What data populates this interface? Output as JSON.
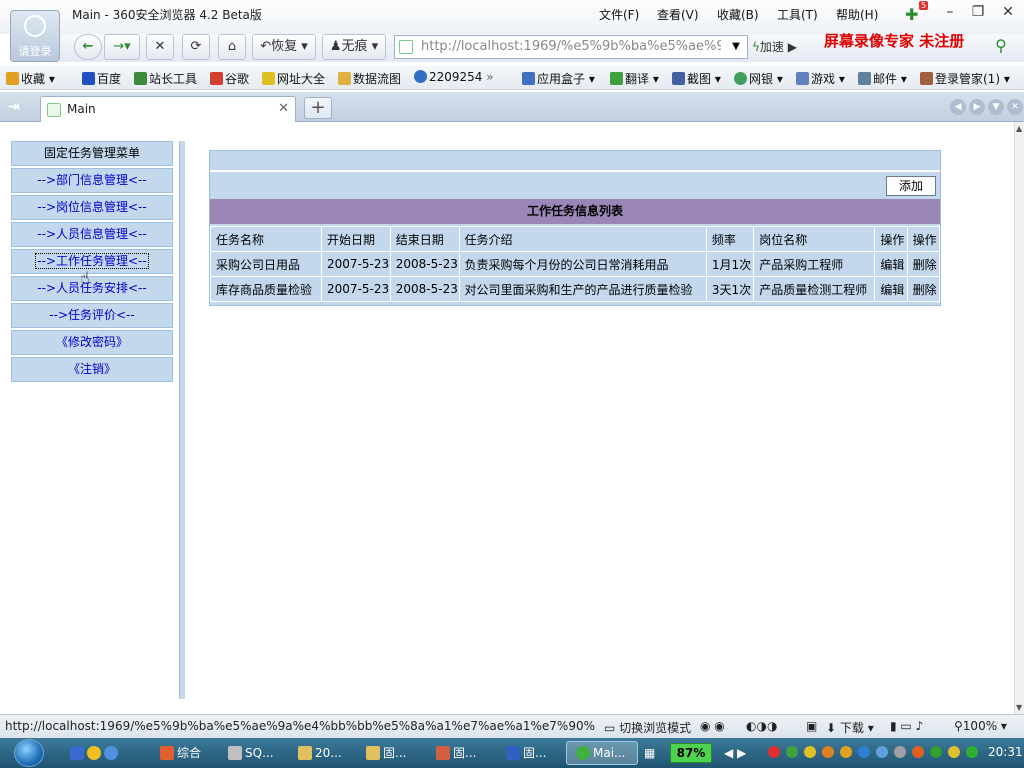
{
  "browser": {
    "window_title": "Main - 360安全浏览器 4.2 Beta版",
    "login_label": "请登录",
    "menu": [
      "文件(F)",
      "查看(V)",
      "收藏(B)",
      "工具(T)",
      "帮助(H)"
    ],
    "notify_count": "5",
    "toolbar": {
      "restore_label": "恢复",
      "notrace_label": "无痕",
      "accelerate_label": "加速"
    },
    "address_url": "http://localhost:1969/%e5%9b%ba%e5%ae%9",
    "watermark": "屏幕录像专家  未注册"
  },
  "bookmarks": [
    {
      "label": "收藏",
      "color": "#e0a020"
    },
    {
      "label": "百度",
      "color": "#2050c0"
    },
    {
      "label": "站长工具",
      "color": "#3a8a3a"
    },
    {
      "label": "谷歌",
      "color": "#d04030"
    },
    {
      "label": "网址大全",
      "color": "#e0c020"
    },
    {
      "label": "数据流图",
      "color": "#e0b040"
    },
    {
      "label": "2209254",
      "color": "#3070c0"
    },
    {
      "label": "应用盒子",
      "color": "#4070c0"
    },
    {
      "label": "翻译",
      "color": "#40a040"
    },
    {
      "label": "截图",
      "color": "#4060a0"
    },
    {
      "label": "网银",
      "color": "#40a060"
    },
    {
      "label": "游戏",
      "color": "#6080c0"
    },
    {
      "label": "邮件",
      "color": "#6080a0"
    },
    {
      "label": "登录管家(1)",
      "color": "#a06040"
    }
  ],
  "tab": {
    "label": "Main"
  },
  "left_menu": {
    "title": "固定任务管理菜单",
    "items": [
      "-->部门信息管理<--",
      "-->岗位信息管理<--",
      "-->人员信息管理<--",
      "-->工作任务管理<--",
      "-->人员任务安排<--",
      "-->任务评价<--",
      "《修改密码》",
      "《注销》"
    ]
  },
  "main": {
    "add_label": "添加",
    "list_title": "工作任务信息列表",
    "columns": [
      "任务名称",
      "开始日期",
      "结束日期",
      "任务介绍",
      "频率",
      "岗位名称",
      "操作",
      "操作"
    ],
    "rows": [
      [
        "采购公司日用品",
        "2007-5-23",
        "2008-5-23",
        "负责采购每个月份的公司日常消耗用品",
        "1月1次",
        "产品采购工程师",
        "编辑",
        "删除"
      ],
      [
        "库存商品质量检验",
        "2007-5-23",
        "2008-5-23",
        "对公司里面采购和生产的产品进行质量检验",
        "3天1次",
        "产品质量检测工程师",
        "编辑",
        "删除"
      ]
    ]
  },
  "statusbar": {
    "url": "http://localhost:1969/%e5%9b%ba%e5%ae%9a%e4%bb%bb%e5%8a%a1%e7%ae%a1%e7%90%8...",
    "switch_mode": "切换浏览模式",
    "download": "下载",
    "zoom": "100%"
  },
  "taskbar": {
    "items": [
      "综合",
      "SQ...",
      "20...",
      "固...",
      "固...",
      "固...",
      "Mai..."
    ],
    "battery": "87%",
    "clock": "20:31"
  }
}
